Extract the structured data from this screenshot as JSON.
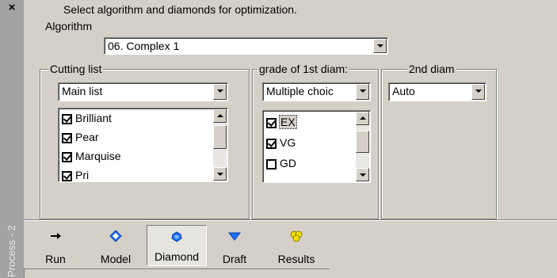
{
  "window": {
    "close_glyph": "×",
    "side_label": "Process - 2"
  },
  "header": {
    "title": "Select algorithm and diamonds for optimization."
  },
  "algorithm": {
    "label": "Algorithm",
    "value": "06. Complex 1"
  },
  "cutting_list": {
    "legend": "Cutting list",
    "selected": "Main list",
    "items": [
      {
        "label": "Brilliant",
        "checked": true
      },
      {
        "label": "Pear",
        "checked": true
      },
      {
        "label": "Marquise",
        "checked": true
      },
      {
        "label": "Pri",
        "checked": true
      }
    ]
  },
  "grade_first": {
    "legend": "grade of 1st diam:",
    "selected": "Multiple choic",
    "items": [
      {
        "label": "EX",
        "checked": true
      },
      {
        "label": "VG",
        "checked": true
      },
      {
        "label": "GD",
        "checked": false
      }
    ]
  },
  "second_diam": {
    "legend": "2nd diam",
    "selected": "Auto"
  },
  "toolbar": {
    "items": [
      {
        "label": "Run",
        "icon": "run-arrow-icon",
        "active": false
      },
      {
        "label": "Model",
        "icon": "model-diamond-icon",
        "active": false
      },
      {
        "label": "Diamond",
        "icon": "diamond-icon",
        "active": true
      },
      {
        "label": "Draft",
        "icon": "draft-triangle-icon",
        "active": false
      },
      {
        "label": "Results",
        "icon": "results-icon",
        "active": false
      }
    ]
  },
  "colors": {
    "panel": "#d4d0c8",
    "strip": "#a3a3a3",
    "icon_blue": "#1e6fff",
    "icon_yellow": "#f0e000"
  }
}
